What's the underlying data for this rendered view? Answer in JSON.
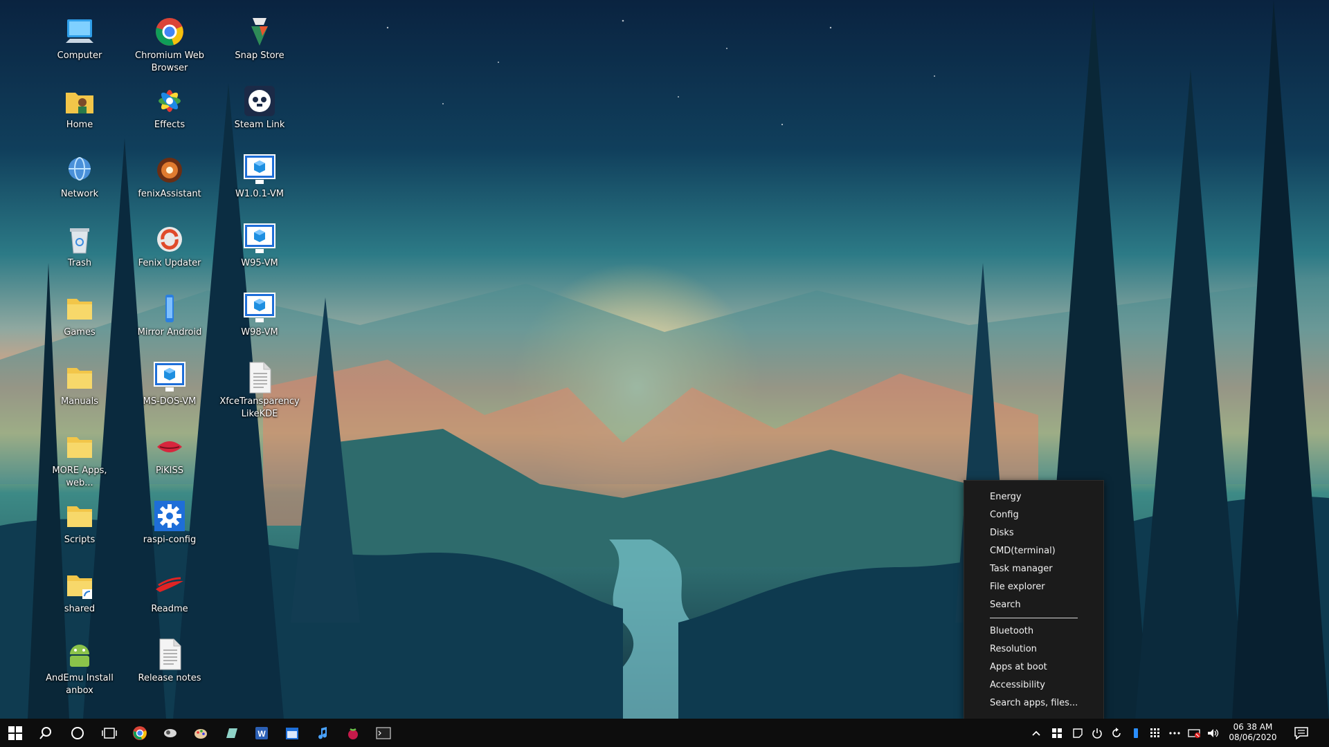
{
  "desktop": {
    "icons": [
      {
        "label": "Computer",
        "icon": "computer-icon"
      },
      {
        "label": "Home",
        "icon": "home-folder-icon"
      },
      {
        "label": "Network",
        "icon": "network-icon"
      },
      {
        "label": "Trash",
        "icon": "trash-icon"
      },
      {
        "label": "Games",
        "icon": "folder-icon"
      },
      {
        "label": "Manuals",
        "icon": "folder-icon"
      },
      {
        "label": "MORE Apps, web...",
        "icon": "folder-icon"
      },
      {
        "label": "Scripts",
        "icon": "folder-icon"
      },
      {
        "label": "shared",
        "icon": "folder-link-icon"
      },
      {
        "label": "AndEmu Install anbox",
        "icon": "android-icon"
      },
      {
        "label": "Chromium Web Browser",
        "icon": "chromium-icon"
      },
      {
        "label": "Effects",
        "icon": "effects-flower-icon"
      },
      {
        "label": "fenixAssistant",
        "icon": "fenix-assistant-icon"
      },
      {
        "label": "Fenix Updater",
        "icon": "fenix-updater-icon"
      },
      {
        "label": "Mirror Android",
        "icon": "phone-icon"
      },
      {
        "label": "MS-DOS-VM",
        "icon": "vm-monitor-icon"
      },
      {
        "label": "PiKISS",
        "icon": "pikiss-icon"
      },
      {
        "label": "raspi-config",
        "icon": "gear-icon"
      },
      {
        "label": "Readme",
        "icon": "readme-icon"
      },
      {
        "label": "Release notes",
        "icon": "text-file-icon"
      },
      {
        "label": "Snap Store",
        "icon": "snap-store-icon"
      },
      {
        "label": "Steam Link",
        "icon": "steam-link-icon"
      },
      {
        "label": "W1.0.1-VM",
        "icon": "vm-monitor-icon"
      },
      {
        "label": "W95-VM",
        "icon": "vm-monitor-icon"
      },
      {
        "label": "W98-VM",
        "icon": "vm-monitor-icon"
      },
      {
        "label": "XfceTransparencyLikeKDE",
        "icon": "text-file-icon"
      }
    ]
  },
  "context_menu": {
    "items": [
      "Energy",
      "Config",
      "Disks",
      "CMD(terminal)",
      "Task manager",
      "File explorer",
      "Search"
    ],
    "items2": [
      "Bluetooth",
      "Resolution",
      "Apps at boot",
      "Accessibility",
      "Search apps, files..."
    ]
  },
  "taskbar": {
    "start_icon": "windows-start-icon",
    "apps": [
      "search-icon",
      "cortana-circle-icon",
      "task-view-icon",
      "chromium-icon",
      "fenix-icon",
      "paint-icon",
      "notes-icon",
      "word-icon",
      "calendar-icon",
      "music-note-icon",
      "raspberry-icon",
      "terminal-icon"
    ],
    "tray": [
      "chevron-up-icon",
      "windows-flag-icon",
      "notes-icon",
      "power-icon",
      "refresh-icon",
      "bluetooth-icon",
      "grid-icon",
      "more-dots-icon",
      "network-offline-icon",
      "volume-icon"
    ],
    "clock": {
      "time": "06 38 AM",
      "date": "08/06/2020"
    },
    "notification_icon": "notification-icon"
  },
  "colors": {
    "taskbar_bg": "#0d0d0d",
    "menu_bg": "#1b1b1b",
    "accent": "#0078d7"
  }
}
